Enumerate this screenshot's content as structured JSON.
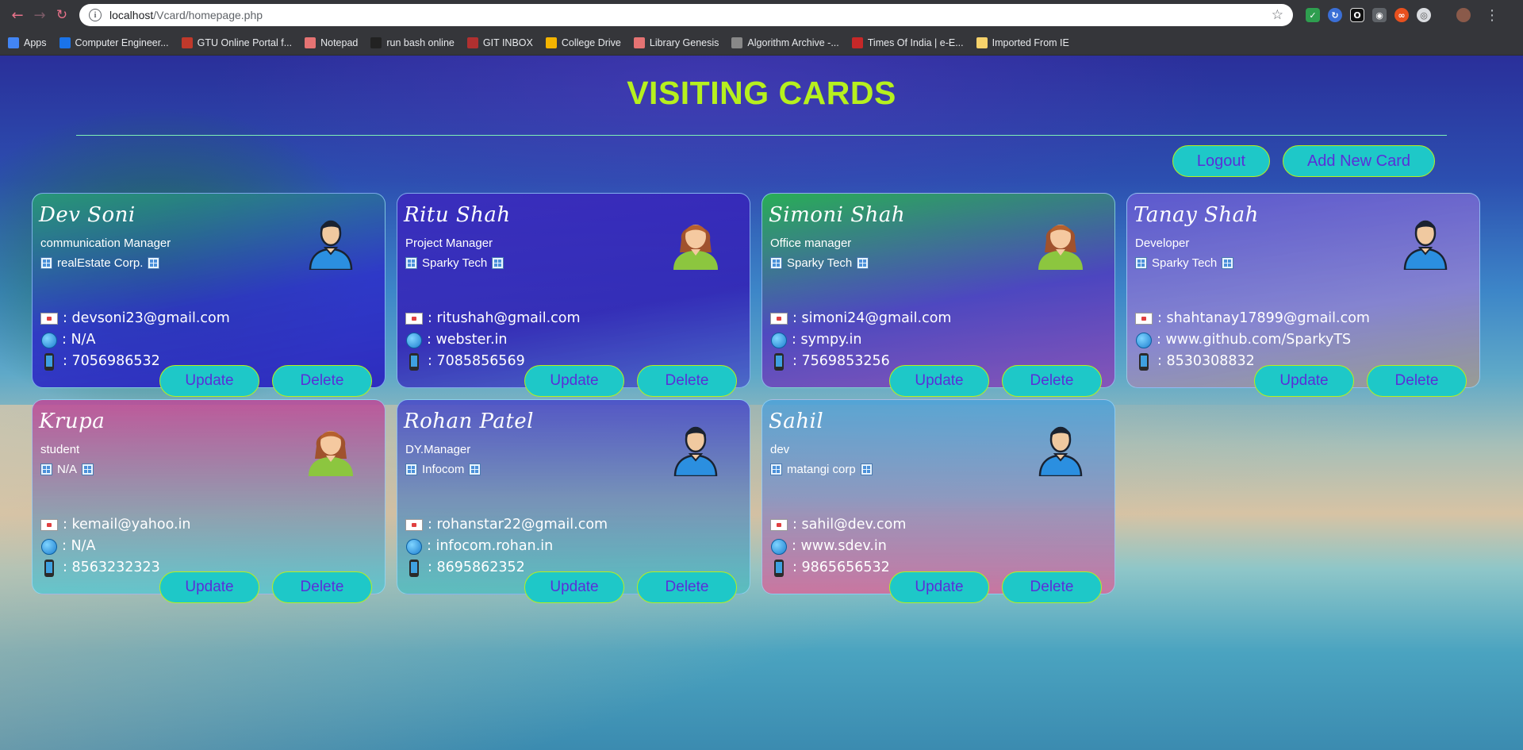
{
  "browser": {
    "url_host": "localhost",
    "url_path": "/Vcard/homepage.php",
    "bookmarks": [
      {
        "label": "Apps",
        "icon": "apps-grid-icon",
        "color": "#4285f4"
      },
      {
        "label": "Computer Engineer...",
        "icon": "bookmark-site-icon",
        "color": "#1a73e8"
      },
      {
        "label": "GTU Online Portal f...",
        "icon": "bookmark-site-icon",
        "color": "#c0392b"
      },
      {
        "label": "Notepad",
        "icon": "document-icon",
        "color": "#e57373"
      },
      {
        "label": "run bash online",
        "icon": "bookmark-site-icon",
        "color": "#222222"
      },
      {
        "label": "GIT INBOX",
        "icon": "bookmark-site-icon",
        "color": "#b03030"
      },
      {
        "label": "College Drive",
        "icon": "google-drive-icon",
        "color": "#f4b400"
      },
      {
        "label": "Library Genesis",
        "icon": "document-icon",
        "color": "#e57373"
      },
      {
        "label": "Algorithm Archive -...",
        "icon": "bookmark-site-icon",
        "color": "#888888"
      },
      {
        "label": "Times Of India | e-E...",
        "icon": "bookmark-site-icon",
        "color": "#c62828"
      },
      {
        "label": "Imported From IE",
        "icon": "folder-icon",
        "color": "#f6d26b"
      }
    ]
  },
  "page": {
    "title": "VISITING CARDS",
    "logout_label": "Logout",
    "add_card_label": "Add New Card"
  },
  "cards": [
    {
      "name": "Dev Soni",
      "role": "communication Manager",
      "company": "realEstate Corp.",
      "email": ": devsoni23@gmail.com",
      "website": ": N/A",
      "phone": ": 7056986532",
      "avatar": "male",
      "theme": "g-blue"
    },
    {
      "name": "Ritu Shah",
      "role": "Project Manager",
      "company": "Sparky Tech",
      "email": ": ritushah@gmail.com",
      "website": ": webster.in",
      "phone": ": 7085856569",
      "avatar": "female",
      "theme": "g-purple"
    },
    {
      "name": "Simoni Shah",
      "role": "Office manager",
      "company": "Sparky Tech",
      "email": ": simoni24@gmail.com",
      "website": ": sympy.in",
      "phone": ": 7569853256",
      "avatar": "female",
      "theme": "g-green"
    },
    {
      "name": "Tanay Shah",
      "role": "Developer",
      "company": "Sparky Tech",
      "email": ": shahtanay17899@gmail.com",
      "website": ": www.github.com/SparkyTS",
      "phone": ": 8530308832",
      "avatar": "male",
      "theme": "g-lav"
    },
    {
      "name": "Krupa",
      "role": "student",
      "company": "N/A",
      "email": ": kemail@yahoo.in",
      "website": ": N/A",
      "phone": ": 8563232323",
      "avatar": "female",
      "theme": "g-pink"
    },
    {
      "name": "Rohan Patel",
      "role": "DY.Manager",
      "company": "Infocom",
      "email": ": rohanstar22@gmail.com",
      "website": ": infocom.rohan.in",
      "phone": ": 8695862352",
      "avatar": "male",
      "theme": "g-teal"
    },
    {
      "name": "Sahil",
      "role": "dev",
      "company": "matangi corp",
      "email": ": sahil@dev.com",
      "website": ": www.sdev.in",
      "phone": ": 9865656532",
      "avatar": "male",
      "theme": "g-rose"
    }
  ],
  "card_actions": {
    "update_label": "Update",
    "delete_label": "Delete"
  },
  "colors": {
    "accent": "#b6f01e",
    "button_bg": "#1ec8c8",
    "button_text": "#5a2fd8"
  }
}
